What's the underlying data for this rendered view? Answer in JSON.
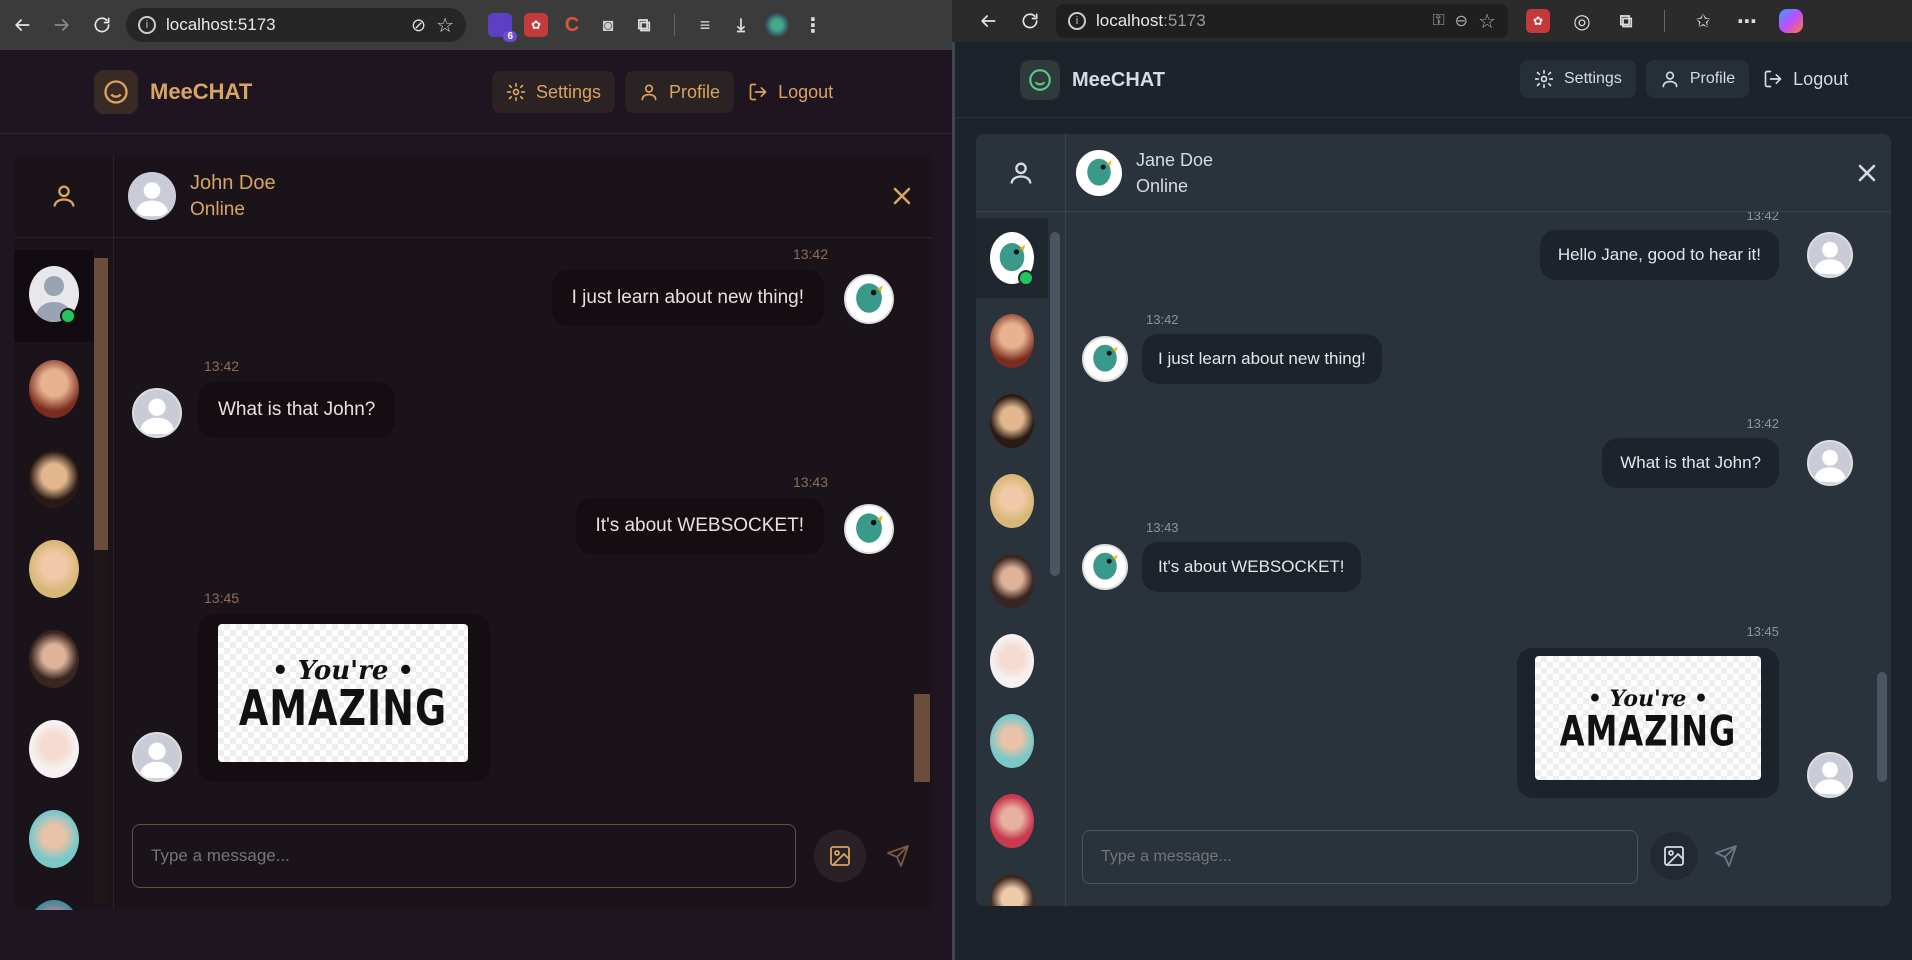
{
  "left_browser": {
    "address": "localhost:5173",
    "extension_badge": "6"
  },
  "right_browser": {
    "address_host": "localhost",
    "address_port": ":5173"
  },
  "app": {
    "brand": "MeeCHAT",
    "nav": {
      "settings": "Settings",
      "profile": "Profile",
      "logout": "Logout"
    },
    "composer_placeholder": "Type a message..."
  },
  "left_chat": {
    "contact_name": "John Doe",
    "contact_status": "Online",
    "messages": [
      {
        "time": "13:42",
        "text": "I just learn about new thing!",
        "side": "out"
      },
      {
        "time": "13:42",
        "text": "What is that John?",
        "side": "in"
      },
      {
        "time": "13:43",
        "text": "It's about WEBSOCKET!",
        "side": "out"
      },
      {
        "time": "13:45",
        "image_text_top": "• You're •",
        "image_text_bottom": "AMAZING",
        "side": "in"
      }
    ]
  },
  "right_chat": {
    "contact_name": "Jane Doe",
    "contact_status": "Online",
    "messages": [
      {
        "time": "13:42",
        "text": "Hello Jane, good to hear it!",
        "side": "out"
      },
      {
        "time": "13:42",
        "text": "I just learn about new thing!",
        "side": "in"
      },
      {
        "time": "13:42",
        "text": "What is that John?",
        "side": "out"
      },
      {
        "time": "13:43",
        "text": "It's about WEBSOCKET!",
        "side": "in"
      },
      {
        "time": "13:45",
        "image_text_top": "• You're •",
        "image_text_bottom": "AMAZING",
        "side": "out"
      }
    ]
  },
  "theme": {
    "left_accent": "#d9a45f",
    "right_accent": "#d6dbe2",
    "online": "#22c55e"
  }
}
